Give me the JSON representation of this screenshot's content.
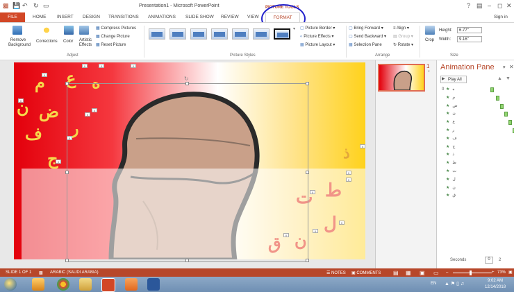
{
  "window": {
    "title": "Presentation1 - Microsoft PowerPoint",
    "context_tab_group": "PICTURE TOOLS",
    "sign_in": "Sign in",
    "help": "?"
  },
  "tabs": [
    "FILE",
    "HOME",
    "INSERT",
    "DESIGN",
    "TRANSITIONS",
    "ANIMATIONS",
    "SLIDE SHOW",
    "REVIEW",
    "VIEW",
    "FORMAT"
  ],
  "ribbon": {
    "adjust": {
      "remove_bg_line1": "Remove",
      "remove_bg_line2": "Background",
      "corrections": "Corrections",
      "color": "Color",
      "artistic_line1": "Artistic",
      "artistic_line2": "Effects",
      "compress": "Compress Pictures",
      "change": "Change Picture",
      "reset": "Reset Picture",
      "label": "Adjust"
    },
    "picture_styles": {
      "label": "Picture Styles",
      "border": "Picture Border",
      "effects": "Picture Effects",
      "layout": "Picture Layout"
    },
    "arrange": {
      "label": "Arrange",
      "bring_forward": "Bring Forward",
      "send_backward": "Send Backward",
      "selection_pane": "Selection Pane",
      "align": "Align",
      "group": "Group",
      "rotate": "Rotate"
    },
    "size": {
      "label": "Size",
      "crop": "Crop",
      "height_label": "Height:",
      "height_value": "6.77\"",
      "width_label": "Width:",
      "width_value": "9.16\""
    }
  },
  "slide": {
    "letters_yellow": [
      "م",
      "ع",
      "ه",
      "ن",
      "ض",
      "ر",
      "ف",
      "ج",
      "ذ"
    ],
    "letters_pink": [
      "ط",
      "ت",
      "ل",
      "ن",
      "ق"
    ],
    "tags": [
      "0",
      "0",
      "0",
      "0",
      "0",
      "0",
      "0",
      "0",
      "0",
      "0",
      "0",
      "0",
      "0",
      "0",
      "0",
      "0"
    ]
  },
  "thumbnail": {
    "number": "1",
    "star": "*"
  },
  "animation_pane": {
    "title": "Animation Pane",
    "play_all": "Play All",
    "rows": [
      {
        "num": "0",
        "glyph": "ه"
      },
      {
        "num": "",
        "glyph": "م"
      },
      {
        "num": "",
        "glyph": "ض"
      },
      {
        "num": "",
        "glyph": "ن"
      },
      {
        "num": "",
        "glyph": "ع"
      },
      {
        "num": "",
        "glyph": "ر"
      },
      {
        "num": "",
        "glyph": "ف"
      },
      {
        "num": "",
        "glyph": "ج"
      },
      {
        "num": "",
        "glyph": "ذ"
      },
      {
        "num": "",
        "glyph": "ط"
      },
      {
        "num": "",
        "glyph": "ت"
      },
      {
        "num": "",
        "glyph": "ل"
      },
      {
        "num": "",
        "glyph": "ن"
      },
      {
        "num": "",
        "glyph": "ق"
      }
    ],
    "seconds_label": "Seconds",
    "timeline_start": "0",
    "timeline_end": "2"
  },
  "status": {
    "slide": "SLIDE 1 OF 1",
    "language": "ARABIC (SAUDI ARABIA)",
    "notes": "NOTES",
    "comments": "COMMENTS",
    "zoom": "73%"
  },
  "taskbar": {
    "lang": "EN",
    "time": "9:02 AM",
    "date": "12/14/2018"
  },
  "colors": {
    "accent": "#b7472a",
    "annotation": "#2222cc",
    "ribbon_tab": "#d24726"
  }
}
